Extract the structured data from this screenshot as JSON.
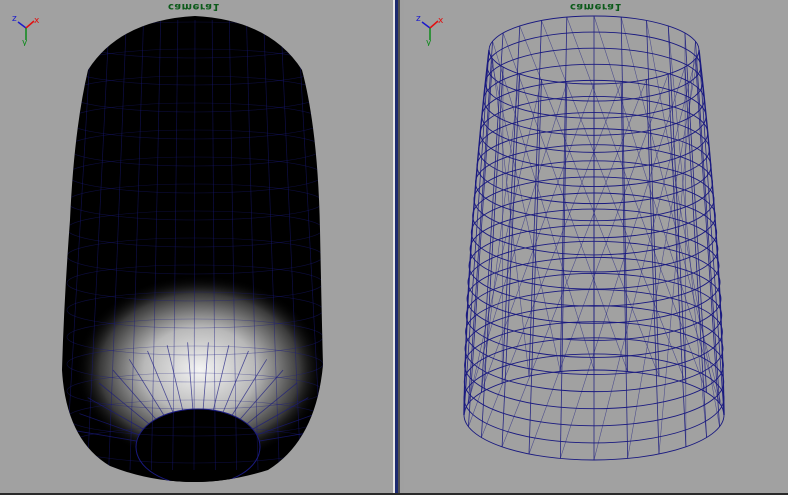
{
  "viewports": {
    "left": {
      "camera_label": "camera1",
      "display_mode": "shaded-wireframe"
    },
    "right": {
      "camera_label": "camera1",
      "display_mode": "wireframe"
    }
  },
  "axis_gizmo": {
    "x": "x",
    "y": "y",
    "z": "z"
  },
  "colors": {
    "background": "#a1a1a1",
    "wire": "#1a1a80",
    "axis_x": "#e11010",
    "axis_y": "#0c8a1a",
    "axis_z": "#1a1acc",
    "label": "#0c5a1a"
  }
}
